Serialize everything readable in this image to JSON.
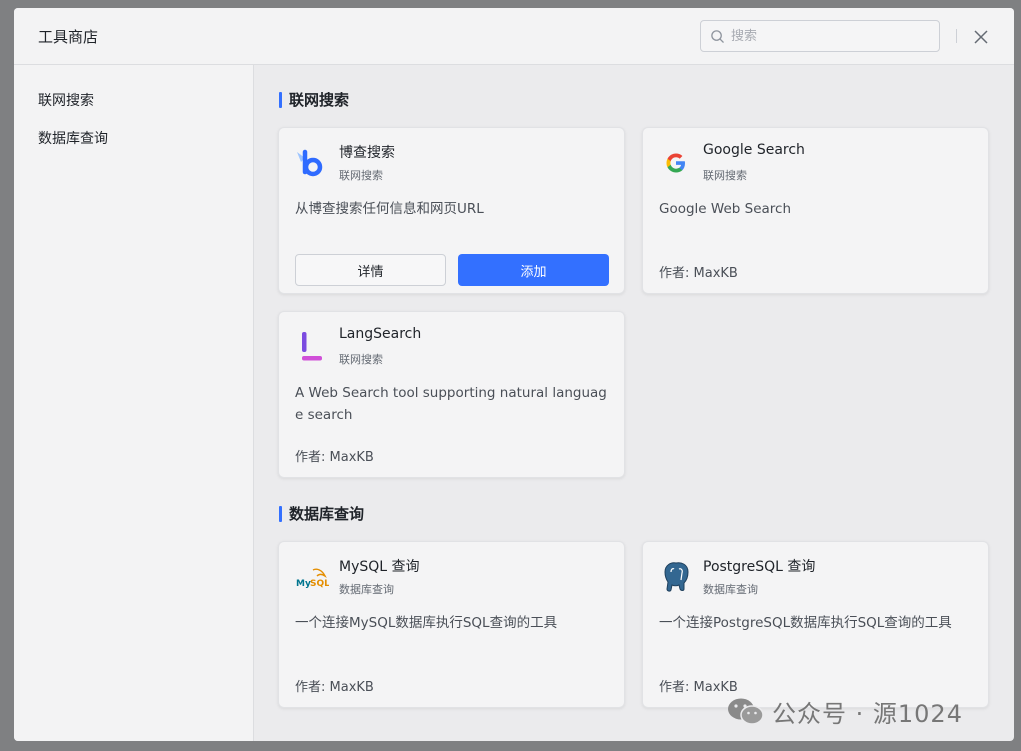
{
  "dialog": {
    "title": "工具商店",
    "search": {
      "placeholder": "搜索",
      "value": ""
    }
  },
  "sidebar": {
    "items": [
      {
        "label": "联网搜索"
      },
      {
        "label": "数据库查询"
      }
    ]
  },
  "sections": [
    {
      "title": "联网搜索",
      "cards": [
        {
          "name": "博查搜索",
          "category": "联网搜索",
          "description": "从博查搜索任何信息和网页URL",
          "detail_label": "详情",
          "add_label": "添加",
          "icon": "bocha-logo-icon"
        },
        {
          "name": "Google Search",
          "category": "联网搜索",
          "description": "Google Web Search",
          "author": "作者: MaxKB",
          "icon": "google-logo-icon"
        },
        {
          "name": "LangSearch",
          "category": "联网搜索",
          "description": "A Web Search tool supporting natural language search",
          "author": "作者: MaxKB",
          "icon": "langsearch-logo-icon"
        }
      ]
    },
    {
      "title": "数据库查询",
      "cards": [
        {
          "name": "MySQL 查询",
          "category": "数据库查询",
          "description": "一个连接MySQL数据库执行SQL查询的工具",
          "author": "作者: MaxKB",
          "icon": "mysql-logo-icon"
        },
        {
          "name": "PostgreSQL 查询",
          "category": "数据库查询",
          "description": "一个连接PostgreSQL数据库执行SQL查询的工具",
          "author": "作者: MaxKB",
          "icon": "postgresql-logo-icon"
        }
      ]
    }
  ],
  "watermark": {
    "text": "公众号 · 源1024"
  },
  "colors": {
    "accent": "#3370ff",
    "overlay": "#7f8082",
    "dialog_bg": "#ebebed",
    "card_bg": "#f4f4f5"
  }
}
